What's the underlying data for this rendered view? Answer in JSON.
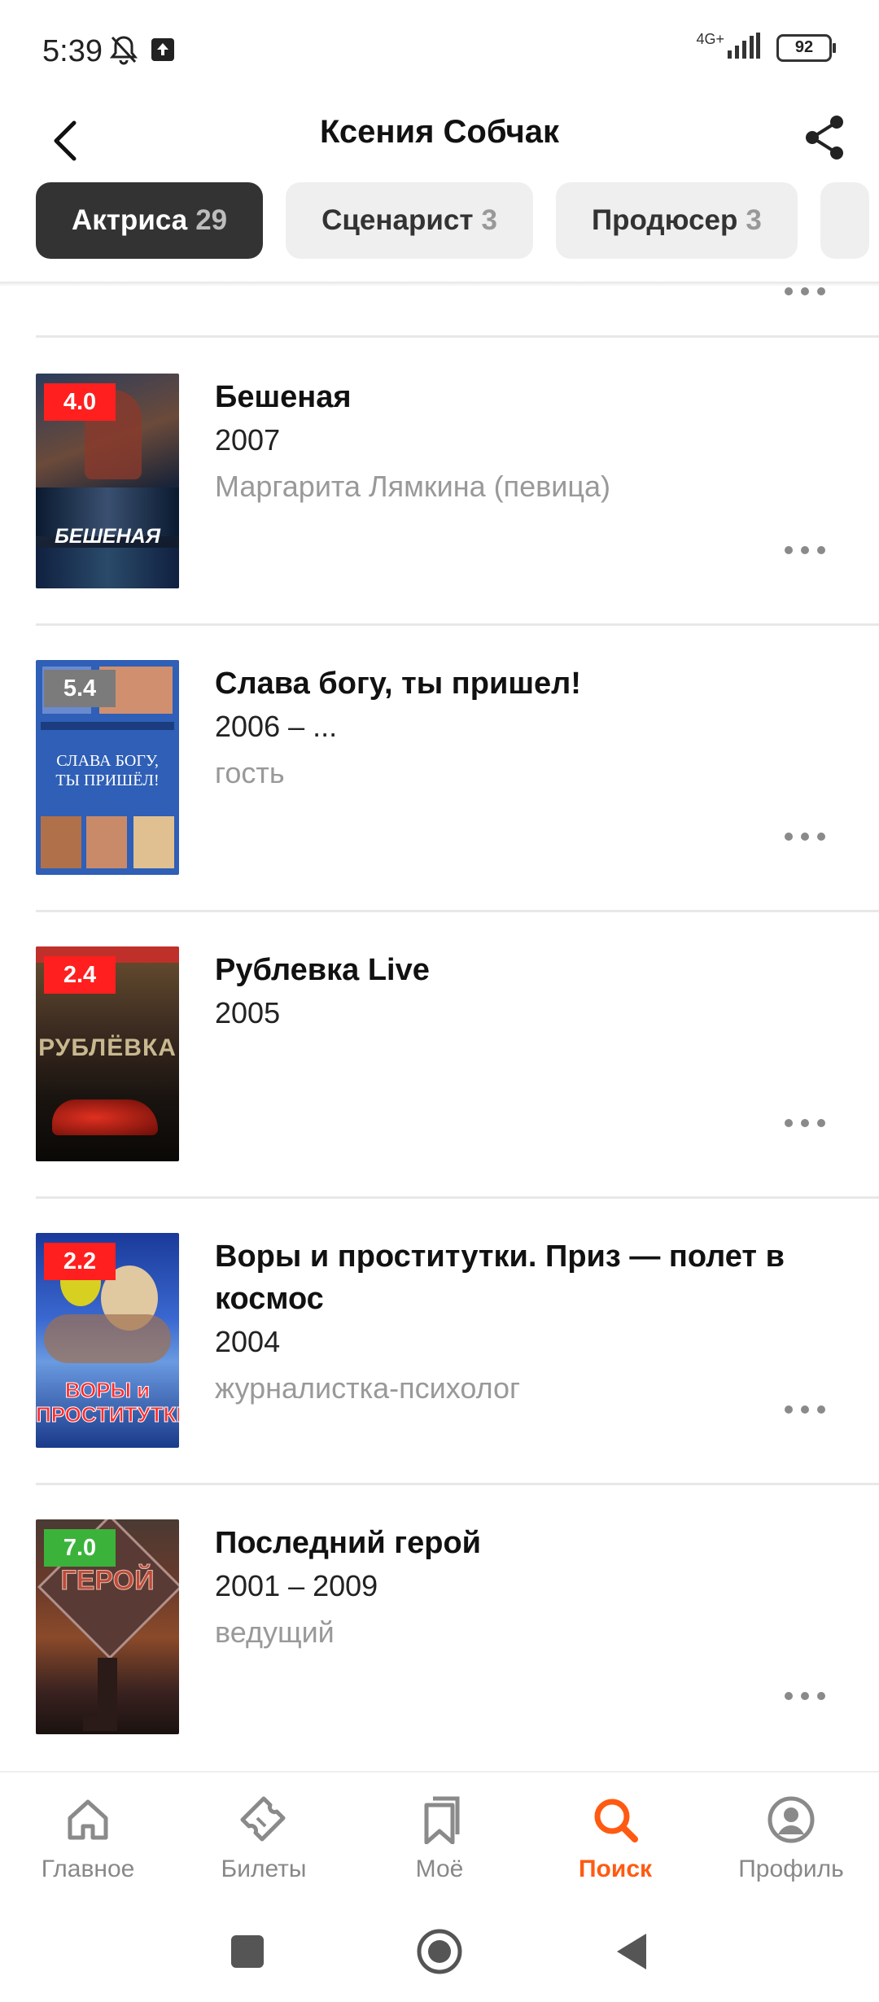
{
  "status_bar": {
    "time": "5:39",
    "network": "4G+",
    "battery": "92",
    "icons": [
      "bell-off-icon",
      "upload-icon",
      "signal-icon",
      "battery-icon"
    ]
  },
  "header": {
    "title": "Ксения Собчак",
    "back_icon": "back-arrow-icon",
    "share_icon": "share-icon"
  },
  "tabs": [
    {
      "label": "Актриса",
      "count": "29",
      "active": true
    },
    {
      "label": "Сценарист",
      "count": "3",
      "active": false
    },
    {
      "label": "Продюсер",
      "count": "3",
      "active": false
    }
  ],
  "films": [
    {
      "title": "Бешеная",
      "year": "2007",
      "role": "Маргарита Лямкина (певица)",
      "rating": "4.0",
      "rating_color": "#ff1f1f",
      "poster_text": "БЕШЕНАЯ"
    },
    {
      "title": "Слава богу, ты пришел!",
      "year": "2006 – ...",
      "role": "гость",
      "rating": "5.4",
      "rating_color": "#7b7b7b",
      "poster_text": "СЛАВА БОГУ, ТЫ ПРИШЁЛ!"
    },
    {
      "title": "Рублевка Live",
      "year": "2005",
      "role": "",
      "rating": "2.4",
      "rating_color": "#ff1f1f",
      "poster_text": "РУБЛЁВКА"
    },
    {
      "title": "Воры и проститутки. Приз — полет в космос",
      "year": "2004",
      "role": "журналистка-психолог",
      "rating": "2.2",
      "rating_color": "#ff1f1f",
      "poster_text": "ВОРЫ и ПРОСТИТУТКИ"
    },
    {
      "title": "Последний герой",
      "year": "2001 – 2009",
      "role": "ведущий",
      "rating": "7.0",
      "rating_color": "#3bb33b",
      "poster_text": "ГЕРОЙ"
    }
  ],
  "bottom_nav": [
    {
      "label": "Главное",
      "icon": "home-icon",
      "active": false
    },
    {
      "label": "Билеты",
      "icon": "ticket-icon",
      "active": false
    },
    {
      "label": "Моё",
      "icon": "bookmark-icon",
      "active": false
    },
    {
      "label": "Поиск",
      "icon": "search-icon",
      "active": true
    },
    {
      "label": "Профиль",
      "icon": "profile-icon",
      "active": false
    }
  ],
  "colors": {
    "accent": "#ff5a12",
    "active_tab": "#333333"
  }
}
